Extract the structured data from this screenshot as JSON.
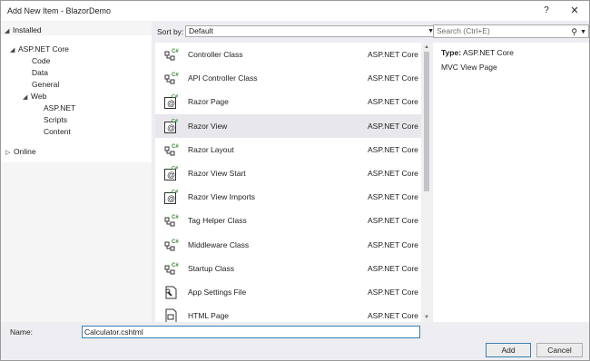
{
  "window": {
    "title": "Add New Item - BlazorDemo",
    "help_glyph": "?",
    "close_glyph": "✕"
  },
  "tree": {
    "installed": "Installed",
    "aspnet_core": "ASP.NET Core",
    "code": "Code",
    "data": "Data",
    "general": "General",
    "web": "Web",
    "aspnet": "ASP.NET",
    "scripts": "Scripts",
    "content": "Content",
    "online": "Online"
  },
  "toolbar": {
    "sort_label": "Sort by:",
    "sort_value": "Default",
    "search_placeholder": "Search (Ctrl+E)"
  },
  "items": [
    {
      "name": "Controller Class",
      "lang": "ASP.NET Core",
      "icon": "csharp-class-icon"
    },
    {
      "name": "API Controller Class",
      "lang": "ASP.NET Core",
      "icon": "csharp-class-icon"
    },
    {
      "name": "Razor Page",
      "lang": "ASP.NET Core",
      "icon": "razor-icon"
    },
    {
      "name": "Razor View",
      "lang": "ASP.NET Core",
      "icon": "razor-icon",
      "selected": true
    },
    {
      "name": "Razor Layout",
      "lang": "ASP.NET Core",
      "icon": "csharp-class-icon"
    },
    {
      "name": "Razor View Start",
      "lang": "ASP.NET Core",
      "icon": "razor-icon"
    },
    {
      "name": "Razor View Imports",
      "lang": "ASP.NET Core",
      "icon": "razor-icon"
    },
    {
      "name": "Tag Helper Class",
      "lang": "ASP.NET Core",
      "icon": "csharp-class-icon"
    },
    {
      "name": "Middleware Class",
      "lang": "ASP.NET Core",
      "icon": "csharp-class-icon"
    },
    {
      "name": "Startup Class",
      "lang": "ASP.NET Core",
      "icon": "csharp-class-icon"
    },
    {
      "name": "App Settings File",
      "lang": "ASP.NET Core",
      "icon": "settings-file-icon"
    },
    {
      "name": "HTML Page",
      "lang": "ASP.NET Core",
      "icon": "html-page-icon"
    }
  ],
  "details": {
    "type_label": "Type:",
    "type_value": "ASP.NET Core",
    "description": "MVC View Page"
  },
  "footer": {
    "name_label": "Name:",
    "name_value": "Calculator.cshtml",
    "add_label": "Add",
    "cancel_label": "Cancel"
  },
  "colors": {
    "accent": "#3c7fb1",
    "csharp_green": "#388a34",
    "selected_row": "#e8e8ec"
  }
}
